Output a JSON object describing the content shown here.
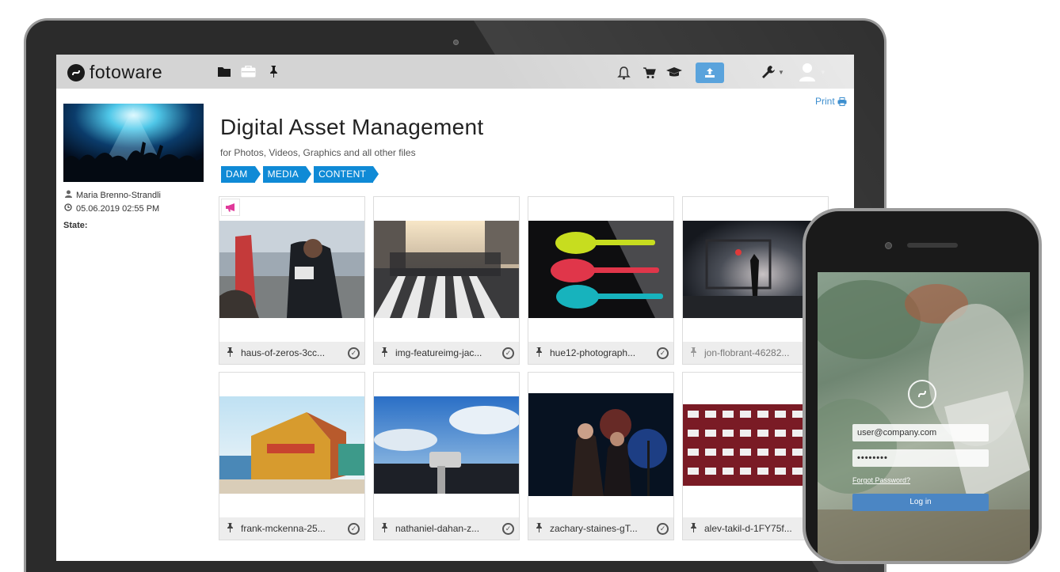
{
  "app": {
    "brand": "fotoware"
  },
  "toolbar": {
    "print_label": "Print"
  },
  "sidebar": {
    "author": "Maria Brenno-Strandli",
    "date": "05.06.2019 02:55 PM",
    "state_label": "State:"
  },
  "main": {
    "title": "Digital Asset Management",
    "subtitle": "for Photos, Videos, Graphics and all other files",
    "tags": [
      "DAM",
      "MEDIA",
      "CONTENT"
    ]
  },
  "assets": [
    {
      "filename": "haus-of-zeros-3cc..."
    },
    {
      "filename": "img-featureimg-jac..."
    },
    {
      "filename": "hue12-photograph..."
    },
    {
      "filename": "jon-flobrant-46282..."
    },
    {
      "filename": "frank-mckenna-25..."
    },
    {
      "filename": "nathaniel-dahan-z..."
    },
    {
      "filename": "zachary-staines-gT..."
    },
    {
      "filename": "alev-takil-d-1FY75f..."
    }
  ],
  "phone": {
    "username_value": "user@company.com",
    "password_value": "••••••••",
    "forgot_label": "Forgot Password?",
    "login_label": "Log in"
  },
  "colors": {
    "accent": "#0f8ad6",
    "upload": "#5aa3dc",
    "link": "#3e8fcf",
    "promo": "#e0399a"
  },
  "icons": {
    "nav": [
      "folder-icon",
      "briefcase-icon",
      "pin-icon"
    ],
    "right": [
      "bell-icon",
      "cart-icon",
      "graduation-cap-icon",
      "upload-icon"
    ],
    "tools": [
      "wrench-icon",
      "user-icon"
    ]
  }
}
